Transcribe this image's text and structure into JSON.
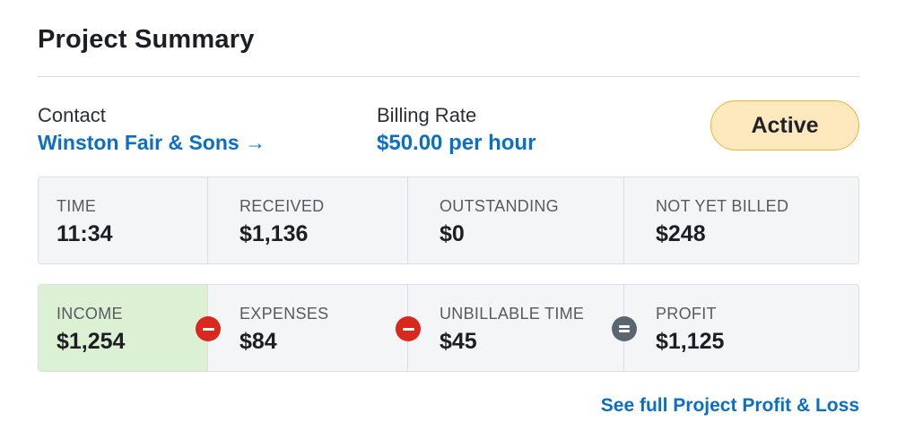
{
  "header": {
    "title": "Project Summary"
  },
  "info": {
    "contact_label": "Contact",
    "contact_value": "Winston Fair & Sons →",
    "rate_label": "Billing Rate",
    "rate_value": "$50.00 per hour",
    "status": "Active"
  },
  "summary": [
    {
      "label": "TIME",
      "value": "11:34"
    },
    {
      "label": "RECEIVED",
      "value": "$1,136"
    },
    {
      "label": "OUTSTANDING",
      "value": "$0"
    },
    {
      "label": "NOT YET BILLED",
      "value": "$248"
    }
  ],
  "profit": [
    {
      "label": "INCOME",
      "value": "$1,254"
    },
    {
      "label": "EXPENSES",
      "value": "$84",
      "operator": "minus-icon"
    },
    {
      "label": "UNBILLABLE TIME",
      "value": "$45",
      "operator": "minus-icon"
    },
    {
      "label": "PROFIT",
      "value": "$1,125",
      "operator": "equals-icon"
    }
  ],
  "footer": {
    "link_label": "See full Project Profit & Loss"
  },
  "colors": {
    "link": "#0b6fc6",
    "badge_bg": "#fde9bd",
    "badge_border": "#e8b63b",
    "income_bg": "#dcf0d4",
    "minus": "#d9281e",
    "equals": "#5b6570"
  }
}
